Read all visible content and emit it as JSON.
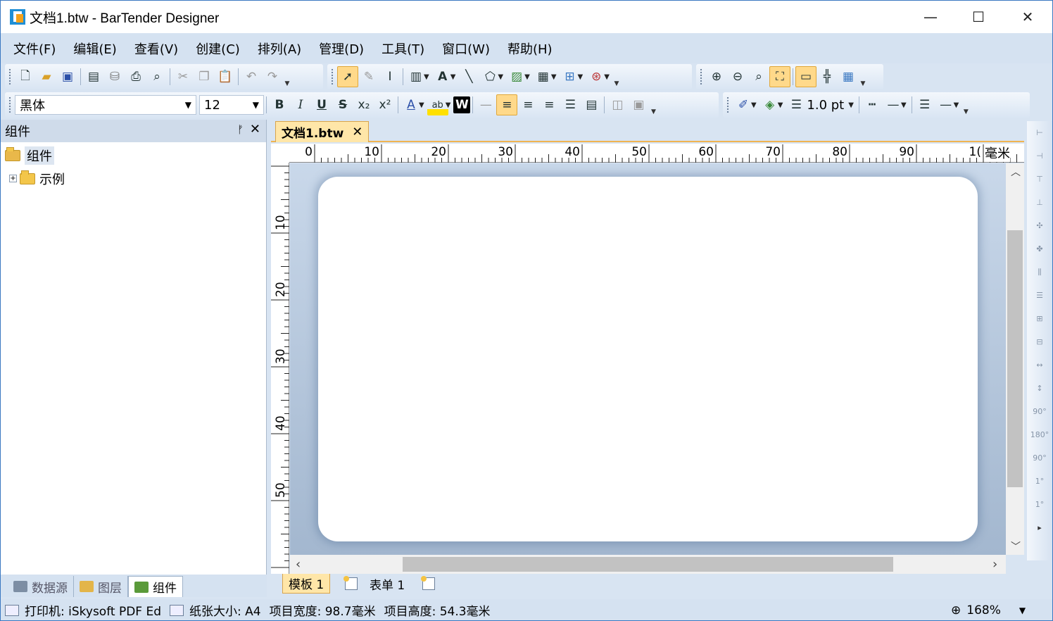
{
  "title": "文档1.btw - BarTender Designer",
  "window_controls": {
    "minimize": "—",
    "maximize": "☐",
    "close": "✕"
  },
  "menu": [
    "文件(F)",
    "编辑(E)",
    "查看(V)",
    "创建(C)",
    "排列(A)",
    "管理(D)",
    "工具(T)",
    "窗口(W)",
    "帮助(H)"
  ],
  "format_toolbar": {
    "font": "黑体",
    "size": "12",
    "bold": "B",
    "italic": "I",
    "underline": "U",
    "strike": "S",
    "subscript": "x₂",
    "superscript": "x²",
    "font_color": "A",
    "highlight": "ab",
    "word": "W",
    "line_width": "1.0 pt"
  },
  "panel": {
    "title": "组件",
    "pin": "ᚠ",
    "close": "✕",
    "tree": {
      "root": "组件",
      "child": "示例",
      "expander": "+"
    }
  },
  "bottom_tabs": [
    "数据源",
    "图层",
    "组件"
  ],
  "document_tab": {
    "name": "文档1.btw",
    "close": "✕"
  },
  "ruler": {
    "unit": "毫米",
    "h_ticks": [
      "0",
      "10",
      "20",
      "30",
      "40",
      "50",
      "60",
      "70",
      "80",
      "90",
      "1("
    ],
    "v_ticks": [
      "10",
      "20",
      "30",
      "40",
      "50"
    ]
  },
  "sheet_tabs": {
    "template": "模板 1",
    "form": "表单 1"
  },
  "status": {
    "printer": "打印机: iSkysoft PDF Ed",
    "paper": "纸张大小: A4",
    "width": "项目宽度: 98.7毫米",
    "height": "项目高度: 54.3毫米",
    "zoom": "168%"
  },
  "right_toolbar": [
    "90°",
    "180°",
    "90°",
    "1°",
    "1°"
  ]
}
